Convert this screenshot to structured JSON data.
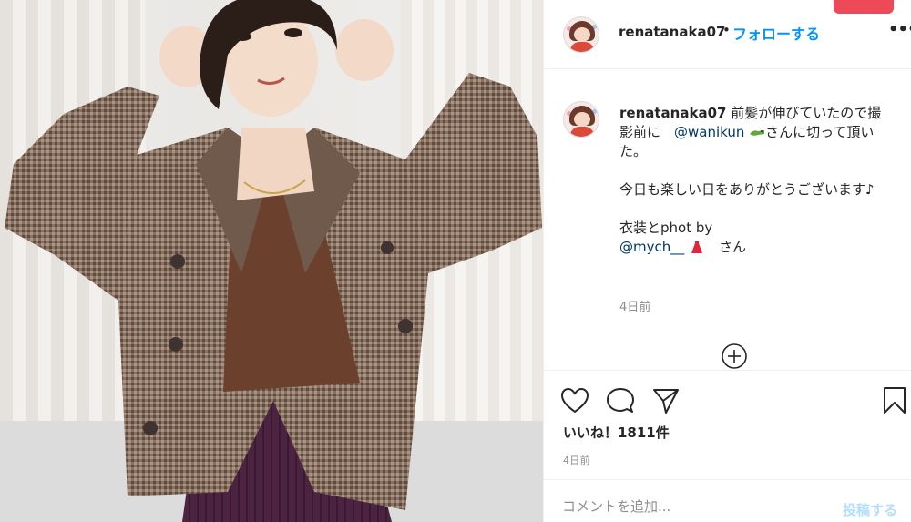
{
  "photo": {
    "subject": ""
  },
  "header": {
    "username": "renatanaka07",
    "separator": "•",
    "follow_label": "フォローする",
    "more_label": "•••"
  },
  "caption": {
    "username": "renatanaka07",
    "line1": " 前髪が伸びていたので撮影前に　",
    "mention1": "@wanikun",
    "emoji1": "crocodile-emoji",
    "line2": "さんに切って頂いた。",
    "line3": "今日も楽しい日をありがとうございます♪",
    "line4": "衣装とphot by",
    "mention2": "@mych__",
    "emoji2": "red-dress-emoji",
    "line5": "　さん",
    "time": "4日前"
  },
  "actions": {
    "likes": "いいね！1811件",
    "time": "4日前"
  },
  "comment": {
    "placeholder": "コメントを追加...",
    "post_label": "投稿する"
  },
  "colors": {
    "follow": "#0095f6",
    "mention": "#00376b",
    "post_disabled": "#b2dffc",
    "jacket": "#7d6556",
    "skirt": "#4a2340",
    "top": "#6a3f2b"
  }
}
